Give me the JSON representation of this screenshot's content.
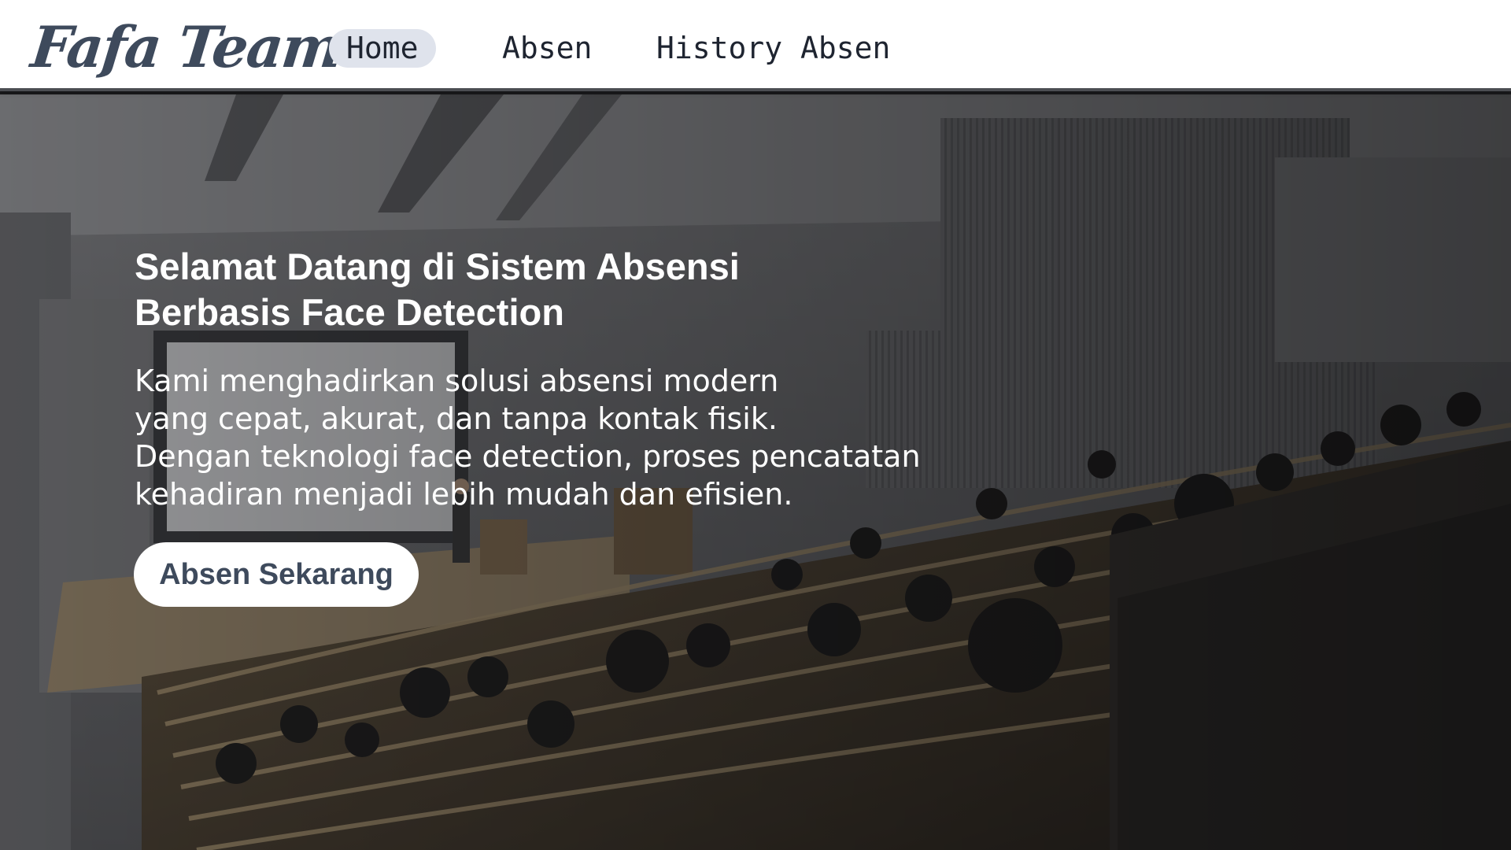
{
  "navbar": {
    "brand": "Fafa Team",
    "links": [
      {
        "label": "Home",
        "active": true
      },
      {
        "label": "Absen",
        "active": false
      },
      {
        "label": "History Absen",
        "active": false
      }
    ]
  },
  "hero": {
    "headline": "Selamat Datang di Sistem Absensi Berbasis Face Detection",
    "description": "Kami menghadirkan solusi absensi modern\nyang cepat, akurat, dan tanpa kontak fisik.\nDengan teknologi face detection, proses pencatatan\nkehadiran menjadi lebih mudah dan efisien.",
    "cta_label": "Absen Sekarang"
  },
  "colors": {
    "brand": "#3e4a5c",
    "nav_active_bg": "#dfe3ec",
    "navbar_bg": "#ffffff",
    "cta_bg": "#ffffff",
    "cta_text": "#3e4a5c"
  }
}
